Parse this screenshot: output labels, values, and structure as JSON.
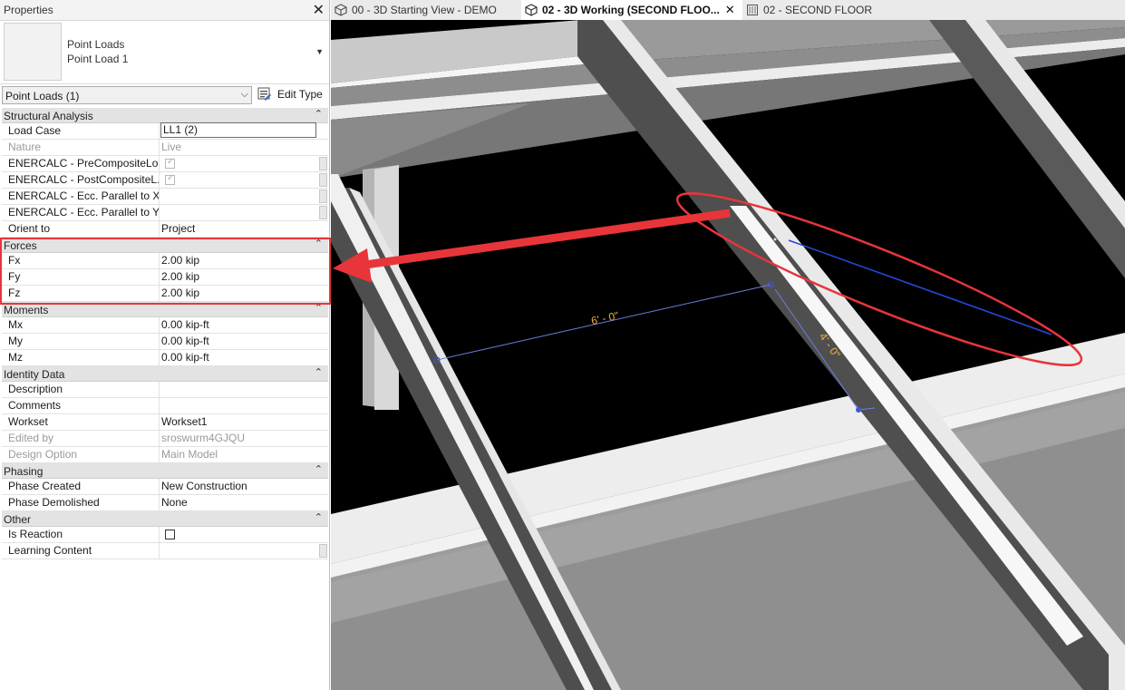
{
  "properties": {
    "title": "Properties",
    "type_line1": "Point Loads",
    "type_line2": "Point Load 1",
    "filter_value": "Point Loads (1)",
    "edit_type_label": "Edit Type",
    "groups": {
      "structural_analysis": "Structural Analysis",
      "forces": "Forces",
      "moments": "Moments",
      "identity_data": "Identity Data",
      "phasing": "Phasing",
      "other": "Other"
    },
    "rows": {
      "load_case": {
        "label": "Load Case",
        "value": "LL1 (2)"
      },
      "nature": {
        "label": "Nature",
        "value": "Live"
      },
      "enercalc_pre": {
        "label": "ENERCALC - PreCompositeLo...",
        "checked": true
      },
      "enercalc_post": {
        "label": "ENERCALC - PostCompositeL...",
        "checked": true
      },
      "enercalc_xx": {
        "label": "ENERCALC - Ecc. Parallel to XX"
      },
      "enercalc_yy": {
        "label": "ENERCALC - Ecc. Parallel to YY"
      },
      "orient_to": {
        "label": "Orient to",
        "value": "Project"
      },
      "fx": {
        "label": "Fx",
        "value": "2.00 kip"
      },
      "fy": {
        "label": "Fy",
        "value": "2.00 kip"
      },
      "fz": {
        "label": "Fz",
        "value": "2.00 kip"
      },
      "mx": {
        "label": "Mx",
        "value": "0.00 kip-ft"
      },
      "my": {
        "label": "My",
        "value": "0.00 kip-ft"
      },
      "mz": {
        "label": "Mz",
        "value": "0.00 kip-ft"
      },
      "description": {
        "label": "Description",
        "value": ""
      },
      "comments": {
        "label": "Comments",
        "value": ""
      },
      "workset": {
        "label": "Workset",
        "value": "Workset1"
      },
      "edited_by": {
        "label": "Edited by",
        "value": "sroswurm4GJQU"
      },
      "design_option": {
        "label": "Design Option",
        "value": "Main Model"
      },
      "phase_created": {
        "label": "Phase Created",
        "value": "New Construction"
      },
      "phase_demolished": {
        "label": "Phase Demolished",
        "value": "None"
      },
      "is_reaction": {
        "label": "Is Reaction",
        "checked": false
      },
      "learning_content": {
        "label": "Learning Content",
        "value": ""
      }
    }
  },
  "tabs": [
    {
      "label": "00 - 3D Starting View - DEMO",
      "icon": "3d-view-icon",
      "active": false
    },
    {
      "label": "02 - 3D Working (SECOND FLOO...",
      "icon": "3d-view-icon",
      "active": true
    },
    {
      "label": "02 - SECOND FLOOR",
      "icon": "floor-plan-icon",
      "active": false
    }
  ],
  "view": {
    "dim_6ft": "6' - 0\"",
    "dim_4ft": "4' - 0\""
  },
  "colors": {
    "highlight_red": "#e8353a",
    "load_line_blue": "#2547d6",
    "dimension_text": "#f0b33a"
  }
}
